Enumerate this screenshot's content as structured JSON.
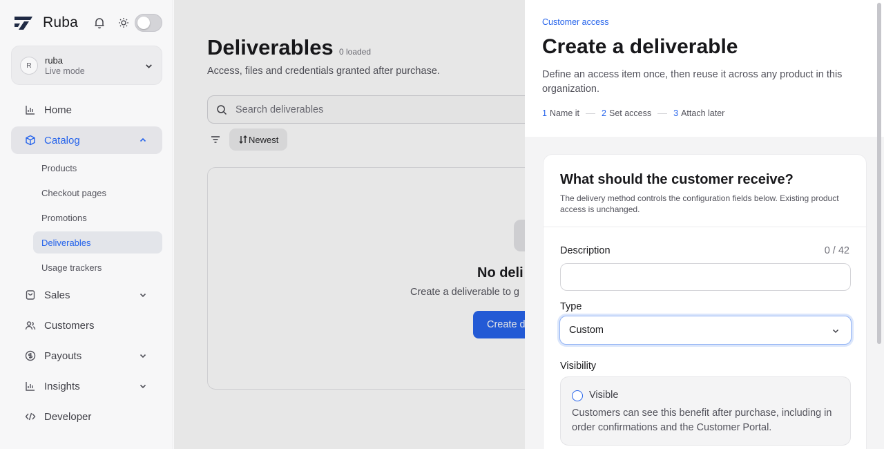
{
  "brand": {
    "name": "Ruba"
  },
  "account": {
    "initial": "R",
    "name": "ruba",
    "mode": "Live mode"
  },
  "nav": {
    "home": "Home",
    "catalog": "Catalog",
    "catalog_items": [
      "Products",
      "Checkout pages",
      "Promotions",
      "Deliverables",
      "Usage trackers"
    ],
    "sales": "Sales",
    "customers": "Customers",
    "payouts": "Payouts",
    "insights": "Insights",
    "developer": "Developer"
  },
  "main": {
    "title": "Deliverables",
    "loaded": "0 loaded",
    "subtitle": "Access, files and credentials granted after purchase.",
    "search_placeholder": "Search deliverables",
    "sort_label": "Newest",
    "empty_title": "No deli",
    "empty_sub": "Create a deliverable to g",
    "empty_button": "Create d"
  },
  "drawer": {
    "eyebrow": "Customer access",
    "title": "Create a deliverable",
    "subtitle": "Define an access item once, then reuse it across any product in this organization.",
    "steps": [
      {
        "num": "1",
        "label": "Name it"
      },
      {
        "num": "2",
        "label": "Set access"
      },
      {
        "num": "3",
        "label": "Attach later"
      }
    ],
    "card": {
      "title": "What should the customer receive?",
      "subtitle": "The delivery method controls the configuration fields below. Existing product access is unchanged.",
      "description_label": "Description",
      "description_value": "",
      "counter": "0 / 42",
      "type_label": "Type",
      "type_value": "Custom",
      "visibility_label": "Visibility",
      "visibility_option": "Visible",
      "visibility_desc": "Customers can see this benefit after purchase, including in order confirmations and the Customer Portal."
    }
  },
  "colors": {
    "accent": "#2563eb",
    "sidebar_bg": "#f7f7f8",
    "drawer_bg": "#f4f4f5"
  },
  "icons": [
    "brand-logo-icon",
    "bell-icon",
    "sun-icon",
    "chevron-down-icon",
    "home-chart-icon",
    "box-icon",
    "bag-icon",
    "users-icon",
    "dollar-circle-icon",
    "insights-chart-icon",
    "code-icon",
    "search-icon",
    "filter-icon",
    "sort-icon"
  ]
}
